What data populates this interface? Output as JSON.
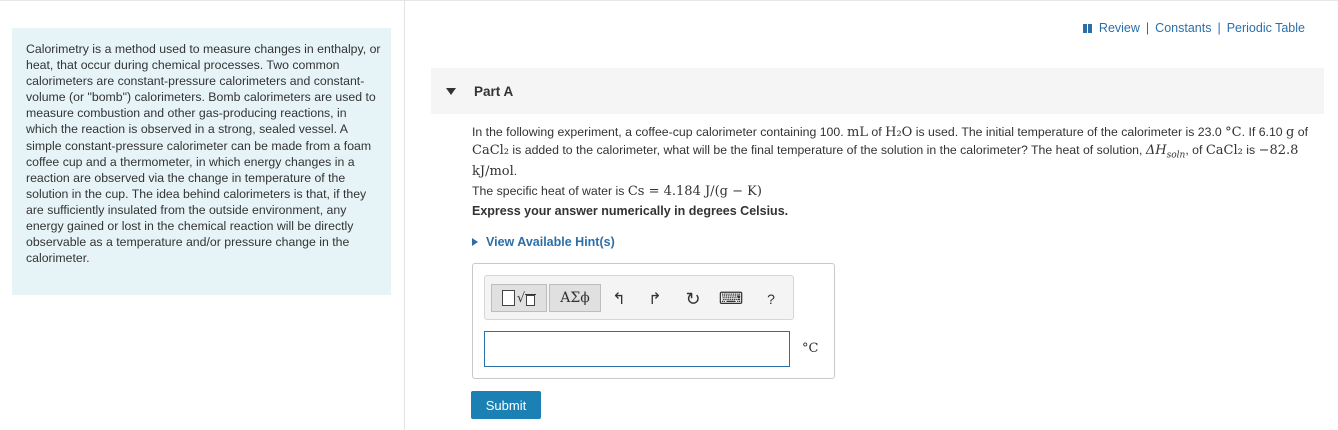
{
  "intro": {
    "text": "Calorimetry is a method used to measure changes in enthalpy, or heat, that occur during chemical processes. Two common calorimeters are constant-pressure calorimeters and constant-volume (or \"bomb\") calorimeters. Bomb calorimeters are used to measure combustion and other gas-producing reactions, in which the reaction is observed in a strong, sealed vessel. A simple constant-pressure calorimeter can be made from a foam coffee cup and a thermometer, in which energy changes in a reaction are observed via the change in temperature of the solution in the cup. The idea behind calorimeters is that, if they are sufficiently insulated from the outside environment, any energy gained or lost in the chemical reaction will be directly observable as a temperature and/or pressure change in the calorimeter."
  },
  "toplinks": {
    "review": "Review",
    "sep1": "|",
    "constants": "Constants",
    "sep2": "|",
    "periodic": "Periodic Table"
  },
  "part": {
    "title": "Part A"
  },
  "question": {
    "t1": "In the following experiment, a coffee-cup calorimeter containing 100. ",
    "m1": "mL",
    "t2": " of ",
    "m2": "H₂O",
    "t3": " is used. The initial temperature of the calorimeter is 23.0 ",
    "m3": "°C",
    "t4": ". If 6.10 ",
    "m4": "g",
    "t5": " of ",
    "m5": "CaCl₂",
    "t6": " is added to the calorimeter, what will be the final temperature of the solution in the calorimeter? The heat of solution, ",
    "m6": "ΔH",
    "m6sub": "soln",
    "t7": ", of ",
    "m7": "CaCl₂",
    "t8": " is ",
    "m8": "−82.8 kJ/mol",
    "t9": ".",
    "s1": "The specific heat of water is ",
    "s2": "Cs",
    "s3": " = 4.184 J/(g − K)"
  },
  "express": "Express your answer numerically in degrees Celsius.",
  "hints": {
    "label": "View Available Hint(s)"
  },
  "toolbar": {
    "greek": "ΑΣϕ",
    "undo": "↰",
    "redo": "↱",
    "reset": "↻",
    "keyboard": "⌨",
    "help": "?"
  },
  "answer": {
    "value": "",
    "unit": "°C"
  },
  "submit": "Submit"
}
